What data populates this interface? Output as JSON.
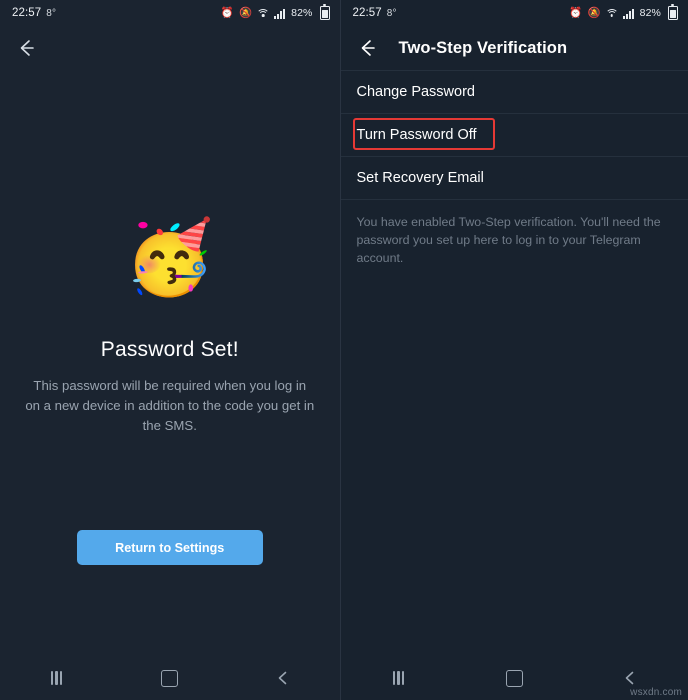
{
  "status_bar": {
    "clock": "22:57",
    "temperature": "8°",
    "alarm_icon": "alarm-clock-icon",
    "mute_icon": "mute-bell-icon",
    "wifi_icon": "wifi-icon",
    "signal_icon": "cellular-signal-icon",
    "battery_percent": "82%",
    "battery_icon": "battery-icon"
  },
  "left_screen": {
    "back_icon": "back-arrow-icon",
    "emoji": "🥳",
    "emoji_name": "party-face-emoji",
    "headline": "Password Set!",
    "description": "This password will be required when you log in on a new device in addition to the code you get in the SMS.",
    "button_label": "Return to Settings",
    "accent_color": "#54a9eb"
  },
  "right_screen": {
    "back_icon": "back-arrow-icon",
    "title": "Two-Step Verification",
    "rows": [
      {
        "label": "Change Password",
        "highlighted": false
      },
      {
        "label": "Turn Password Off",
        "highlighted": true
      },
      {
        "label": "Set Recovery Email",
        "highlighted": false
      }
    ],
    "highlight_color": "#e53935",
    "info_text": "You have enabled Two-Step verification.\nYou'll need the password you set up here to log in to your Telegram account."
  },
  "nav_bar": {
    "recent_icon": "recent-apps-icon",
    "home_icon": "home-icon",
    "back_icon": "back-nav-icon"
  },
  "watermark": "wsxdn.com"
}
